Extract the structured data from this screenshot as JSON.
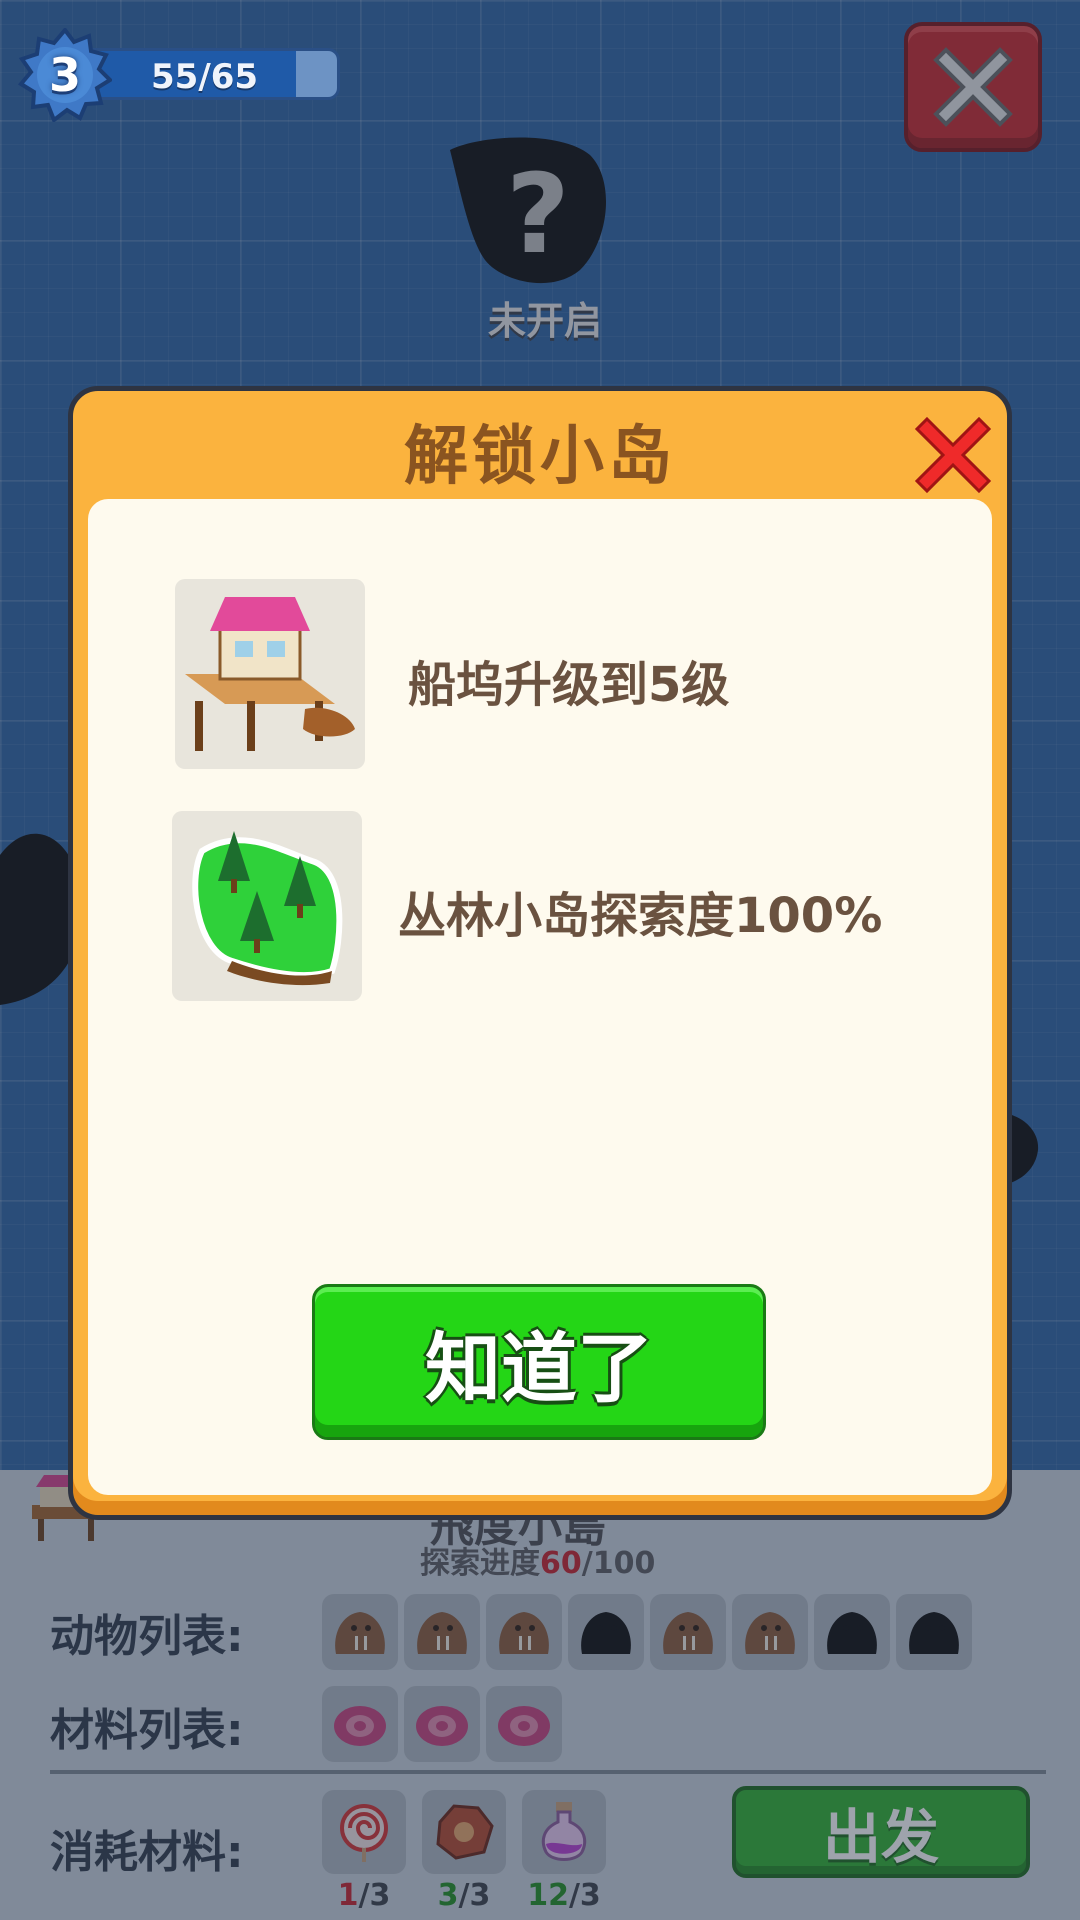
{
  "hud": {
    "level": "3",
    "xp_text": "55/65",
    "xp_fraction": 0.846
  },
  "map": {
    "locked_island_label": "未开启",
    "locked_island_symbol": "?"
  },
  "bottom_panel": {
    "island_name": "飛度小島",
    "progress_label": "探索进度",
    "progress_current": "60",
    "progress_total": "/100",
    "animals_label": "动物列表:",
    "materials_label": "材料列表:",
    "consumables_label": "消耗材料:",
    "go_button": "出发",
    "consumables": [
      {
        "icon": "lollipop-icon",
        "have": "1",
        "need": "/3",
        "color": "#c7202a"
      },
      {
        "icon": "ore-icon",
        "have": "3",
        "need": "/3",
        "color": "#1f8f1f"
      },
      {
        "icon": "potion-icon",
        "have": "12",
        "need": "/3",
        "color": "#1f8f1f"
      }
    ]
  },
  "modal": {
    "title": "解锁小岛",
    "requirements": [
      {
        "icon": "dock-icon",
        "text": "船坞升级到5级"
      },
      {
        "icon": "jungle-island-icon",
        "text": "丛林小岛探索度100%"
      }
    ],
    "confirm_button": "知道了"
  },
  "colors": {
    "background": "#2d63a3",
    "modal_frame": "#fbb33e",
    "confirm_green": "#24d616",
    "close_red": "#c8262a"
  }
}
